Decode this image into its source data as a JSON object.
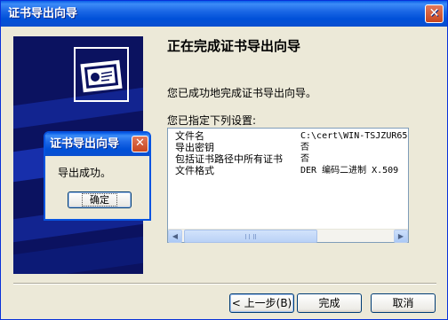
{
  "window": {
    "title": "证书导出向导",
    "close_glyph": "✕"
  },
  "wizard": {
    "heading": "正在完成证书导出向导",
    "success_text": "您已成功地完成证书导出向导。",
    "settings_label": "您已指定下列设置:",
    "settings": [
      {
        "key": "文件名",
        "value": "C:\\cert\\WIN-TSJZUR65"
      },
      {
        "key": "导出密钥",
        "value": "否"
      },
      {
        "key": "包括证书路径中所有证书",
        "value": "否"
      },
      {
        "key": "文件格式",
        "value": "DER 编码二进制 X.509"
      }
    ],
    "scroll_left": "◀",
    "scroll_right": "▶"
  },
  "buttons": {
    "back": "< 上一步(B)",
    "finish": "完成",
    "cancel": "取消"
  },
  "message_box": {
    "title": "证书导出向导",
    "close_glyph": "✕",
    "text": "导出成功。",
    "ok": "确定"
  },
  "icons": {
    "banner_icon": "certificate-icon"
  },
  "colors": {
    "titlebar": "#0050d8",
    "banner": "#0b1260",
    "window_bg": "#ece9d8"
  }
}
